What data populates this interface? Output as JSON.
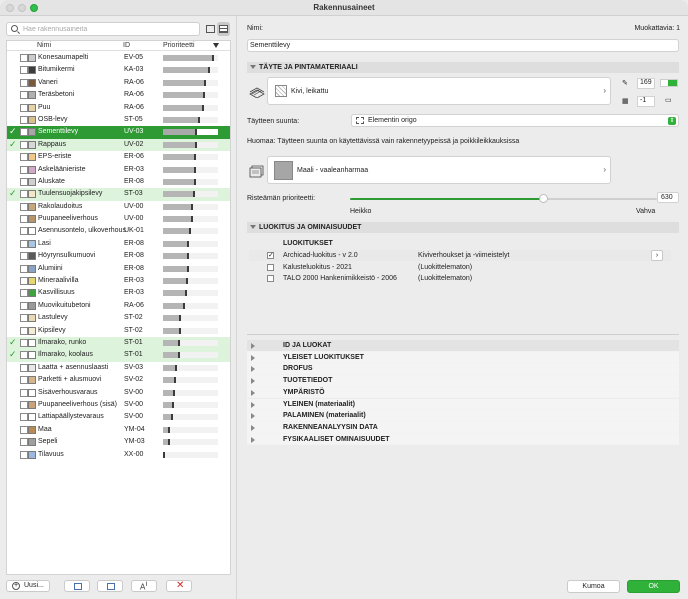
{
  "window": {
    "title": "Rakennusaineet"
  },
  "search": {
    "placeholder": "Hae rakennusaineita"
  },
  "table": {
    "headers": {
      "name": "Nimi",
      "id": "ID",
      "priority": "Prioriteetti"
    },
    "rows": [
      {
        "name": "Konesaumapelti",
        "id": "EV-05",
        "swatch": "#c9cbcf",
        "priority": 0.93,
        "checked": false,
        "state": ""
      },
      {
        "name": "Bitumikermi",
        "id": "KA-03",
        "swatch": "#3d3d3d",
        "priority": 0.85,
        "checked": false,
        "state": ""
      },
      {
        "name": "Vaneri",
        "id": "RA-06",
        "swatch": "#7a5a3a",
        "priority": 0.78,
        "checked": false,
        "state": ""
      },
      {
        "name": "Teräsbetoni",
        "id": "RA-06",
        "swatch": "#b0b0b0",
        "priority": 0.76,
        "checked": false,
        "state": ""
      },
      {
        "name": "Puu",
        "id": "RA-06",
        "swatch": "#e6d3a8",
        "priority": 0.75,
        "checked": false,
        "state": ""
      },
      {
        "name": "OSB-levy",
        "id": "ST-05",
        "swatch": "#d9c08a",
        "priority": 0.68,
        "checked": false,
        "state": ""
      },
      {
        "name": "Sementtilevy",
        "id": "UV-03",
        "swatch": "#a7a7a7",
        "priority": 0.62,
        "checked": true,
        "state": "sel"
      },
      {
        "name": "Rappaus",
        "id": "UV-02",
        "swatch": "#d7d7d7",
        "priority": 0.62,
        "checked": true,
        "state": "green"
      },
      {
        "name": "EPS-eriste",
        "id": "ER-06",
        "swatch": "#f0c98a",
        "priority": 0.6,
        "checked": false,
        "state": ""
      },
      {
        "name": "Askeläänieriste",
        "id": "ER-03",
        "swatch": "#d3a9c9",
        "priority": 0.6,
        "checked": false,
        "state": ""
      },
      {
        "name": "Aluskate",
        "id": "ER-08",
        "swatch": "#d0d0d0",
        "priority": 0.6,
        "checked": false,
        "state": ""
      },
      {
        "name": "Tuulensuojakipsilevy",
        "id": "ST-03",
        "swatch": "#f3e7c8",
        "priority": 0.58,
        "checked": true,
        "state": "green"
      },
      {
        "name": "Rakolaudoitus",
        "id": "UV-00",
        "swatch": "#c8a77a",
        "priority": 0.55,
        "checked": false,
        "state": ""
      },
      {
        "name": "Puupaneeliverhous",
        "id": "UV-00",
        "swatch": "#b8946a",
        "priority": 0.55,
        "checked": false,
        "state": ""
      },
      {
        "name": "Asennusontelo, ulkoverhous",
        "id": "UK-01",
        "swatch": "#ffffff",
        "priority": 0.5,
        "checked": false,
        "state": ""
      },
      {
        "name": "Lasi",
        "id": "ER-08",
        "swatch": "#a9c6e6",
        "priority": 0.48,
        "checked": false,
        "state": ""
      },
      {
        "name": "Höyrynsulkumuovi",
        "id": "ER-08",
        "swatch": "#5a5a5a",
        "priority": 0.47,
        "checked": false,
        "state": ""
      },
      {
        "name": "Alumiini",
        "id": "ER-08",
        "swatch": "#8aa4c8",
        "priority": 0.47,
        "checked": false,
        "state": ""
      },
      {
        "name": "Mineraalivilla",
        "id": "ER-03",
        "swatch": "#e8d670",
        "priority": 0.45,
        "checked": false,
        "state": ""
      },
      {
        "name": "Kasvillisuus",
        "id": "ER-03",
        "swatch": "#3fa33f",
        "priority": 0.44,
        "checked": false,
        "state": ""
      },
      {
        "name": "Muovikuitubetoni",
        "id": "RA-06",
        "swatch": "#9a9a9a",
        "priority": 0.4,
        "checked": false,
        "state": ""
      },
      {
        "name": "Lastulevy",
        "id": "ST-02",
        "swatch": "#e9d9b5",
        "priority": 0.33,
        "checked": false,
        "state": ""
      },
      {
        "name": "Kipsilevy",
        "id": "ST-02",
        "swatch": "#f4ecd6",
        "priority": 0.32,
        "checked": false,
        "state": ""
      },
      {
        "name": "Ilmarako, runko",
        "id": "ST-01",
        "swatch": "#ffffff",
        "priority": 0.3,
        "checked": true,
        "state": "green"
      },
      {
        "name": "Ilmarako, koolaus",
        "id": "ST-01",
        "swatch": "#ffffff",
        "priority": 0.3,
        "checked": true,
        "state": "green"
      },
      {
        "name": "Laatta + asennuslaasti",
        "id": "SV-03",
        "swatch": "#e8e8e8",
        "priority": 0.25,
        "checked": false,
        "state": ""
      },
      {
        "name": "Parketti + alusmuovi",
        "id": "SV-02",
        "swatch": "#d7b58a",
        "priority": 0.23,
        "checked": false,
        "state": ""
      },
      {
        "name": "Sisäverhousvaraus",
        "id": "SV-00",
        "swatch": "#ffffff",
        "priority": 0.21,
        "checked": false,
        "state": ""
      },
      {
        "name": "Puupaneeliverhous (sisä)",
        "id": "SV-00",
        "swatch": "#c9a27a",
        "priority": 0.2,
        "checked": false,
        "state": ""
      },
      {
        "name": "Lattiapäällystevaraus",
        "id": "SV-00",
        "swatch": "#ffffff",
        "priority": 0.19,
        "checked": false,
        "state": ""
      },
      {
        "name": "Maa",
        "id": "YM-04",
        "swatch": "#b88a55",
        "priority": 0.13,
        "checked": false,
        "state": ""
      },
      {
        "name": "Sepeli",
        "id": "YM-03",
        "swatch": "#9f9f9f",
        "priority": 0.12,
        "checked": false,
        "state": ""
      },
      {
        "name": "Tilavuus",
        "id": "XX-00",
        "swatch": "#9ab8e0",
        "priority": 0.03,
        "checked": false,
        "state": ""
      }
    ]
  },
  "bottom": {
    "new_label": "Uusi..."
  },
  "detail": {
    "name_label": "Nimi:",
    "edited_label": "Muokattavia: 1",
    "name_value": "Sementtilevy",
    "section_fill": "TÄYTE JA PINTAMATERIAALI",
    "fill_name": "Kivi, leikattu",
    "pen1": "169",
    "pen2": "-1",
    "direction_label": "Täytteen suunta:",
    "direction_value": "Elementin origo",
    "note": "Huomaa: Täytteen suunta on käytettävissä vain rakennetyypeissä ja poikkileikkauksissa",
    "surface_name": "Maali - vaaleanharmaa",
    "priority_label": "Risteämän prioriteetti:",
    "priority_value": "630",
    "priority_fraction": 0.63,
    "weak_label": "Heikko",
    "strong_label": "Vahva",
    "section_class": "LUOKITUS JA OMINAISUUDET",
    "class_header": "LUOKITUKSET",
    "classifications": [
      {
        "name": "Archicad-luokitus - v 2.0",
        "value": "Kiviverhoukset ja -viimeistelyt",
        "checked": true
      },
      {
        "name": "Kalusteluokitus - 2021",
        "value": "(Luokittelematon)",
        "checked": false
      },
      {
        "name": "TALO 2000 Hankenimikkeistö - 2006",
        "value": "(Luokittelematon)",
        "checked": false
      }
    ],
    "properties": [
      "ID JA LUOKAT",
      "YLEISET LUOKITUKSET",
      "DROFUS",
      "TUOTETIEDOT",
      "YMPÄRISTÖ",
      "YLEINEN (materiaalit)",
      "PALAMINEN (materiaalit)",
      "RAKENNEANALYYSIN DATA",
      "FYSIKAALISET OMINAISUUDET"
    ]
  },
  "buttons": {
    "cancel": "Kumoa",
    "ok": "OK"
  }
}
